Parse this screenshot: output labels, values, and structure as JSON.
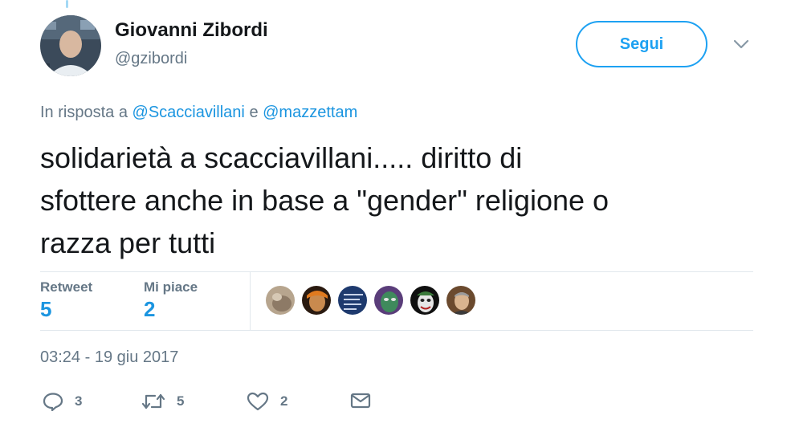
{
  "author": {
    "name": "Giovanni Zibordi",
    "handle": "@gzibordi"
  },
  "follow_button_label": "Segui",
  "reply_context": {
    "prefix": "In risposta a",
    "mention1": "@Scacciavillani",
    "joiner": "e",
    "mention2": "@mazzettam"
  },
  "tweet_text": "solidarietà a scacciavillani..... diritto di\nsfottere anche in base a \"gender\" religione o\nrazza per tutti",
  "stats": {
    "retweet_label": "Retweet",
    "retweet_count": "5",
    "likes_label": "Mi piace",
    "likes_count": "2"
  },
  "timestamp": "03:24 - 19 giu 2017",
  "actions": {
    "reply_count": "3",
    "retweet_count": "5",
    "like_count": "2"
  },
  "icons": {
    "caret": "chevron-down-icon",
    "reply": "reply-icon",
    "retweet": "retweet-icon",
    "like": "heart-icon",
    "message": "envelope-icon"
  },
  "colors": {
    "accent": "#1da1f2",
    "link": "#1b95e0",
    "secondary_text": "#657786",
    "primary_text": "#14171a",
    "divider": "#e1e8ed"
  }
}
